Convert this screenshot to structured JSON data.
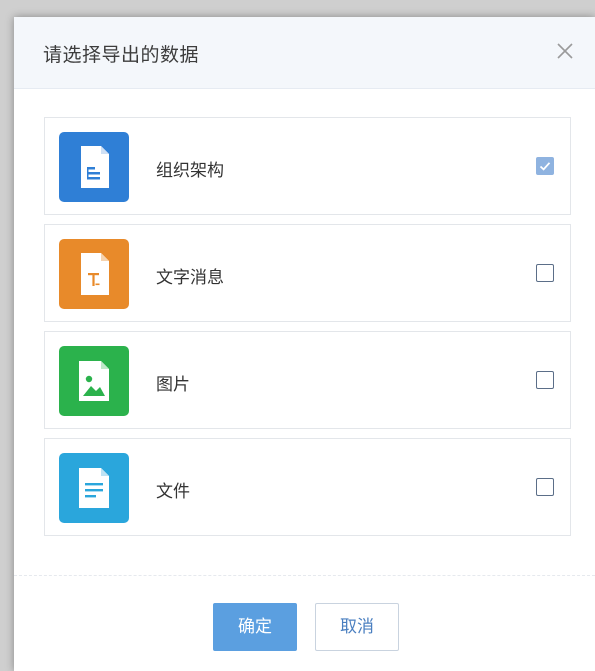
{
  "dialog": {
    "title": "请选择导出的数据",
    "close_icon": "close-icon"
  },
  "options": [
    {
      "label": "组织架构",
      "icon": "org-chart-file-icon",
      "icon_color": "#2f7fd6",
      "checked": true
    },
    {
      "label": "文字消息",
      "icon": "text-file-icon",
      "icon_color": "#e88a2a",
      "checked": false
    },
    {
      "label": "图片",
      "icon": "image-file-icon",
      "icon_color": "#2bb24c",
      "checked": false
    },
    {
      "label": "文件",
      "icon": "document-file-icon",
      "icon_color": "#2aa6dc",
      "checked": false
    }
  ],
  "buttons": {
    "confirm_label": "确定",
    "cancel_label": "取消"
  },
  "colors": {
    "accent": "#5b9fe0",
    "checked_box": "#8fb3e0"
  }
}
